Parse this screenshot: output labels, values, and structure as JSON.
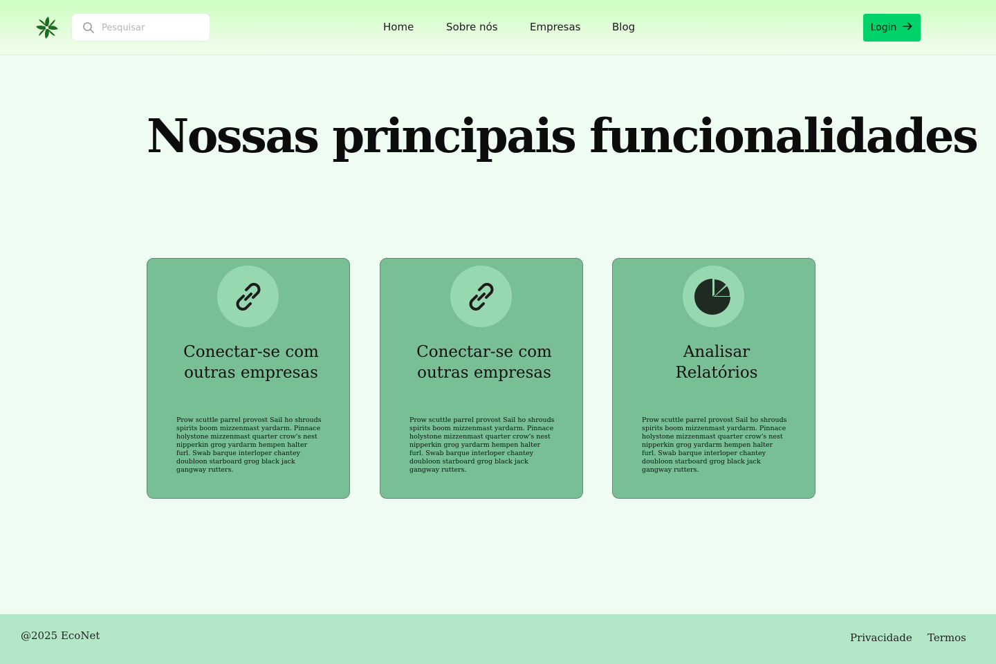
{
  "brand": {
    "logo_icon": "pinwheel-logo-icon",
    "logo_color": "#1f6b1f"
  },
  "search": {
    "placeholder": "Pesquisar",
    "value": "",
    "icon": "search-icon"
  },
  "nav": {
    "items": [
      {
        "label": "Home"
      },
      {
        "label": "Sobre nós"
      },
      {
        "label": "Empresas"
      },
      {
        "label": "Blog"
      }
    ]
  },
  "login": {
    "label": "Login",
    "icon": "arrow-right-icon",
    "color": "#00d26a"
  },
  "hero": {
    "title": "Nossas principais funcionalidades"
  },
  "features": [
    {
      "icon": "link-icon",
      "title": "Conectar-se com outras empresas",
      "text": "Prow scuttle parrel provost Sail ho shrouds spirits boom mizzenmast yardarm. Pinnace holystone mizzenmast quarter crow's nest nipperkin grog yardarm hempen halter furl. Swab barque interloper chantey doubloon starboard grog black jack gangway rutters."
    },
    {
      "icon": "link-icon",
      "title": "Conectar-se com outras empresas",
      "text": "Prow scuttle parrel provost Sail ho shrouds spirits boom mizzenmast yardarm. Pinnace holystone mizzenmast quarter crow's nest nipperkin grog yardarm hempen halter furl. Swab barque interloper chantey doubloon starboard grog black jack gangway rutters."
    },
    {
      "icon": "pie-chart-icon",
      "title": "Analisar Relatórios",
      "text": "Prow scuttle parrel provost Sail ho shrouds spirits boom mizzenmast yardarm. Pinnace holystone mizzenmast quarter crow's nest nipperkin grog yardarm hempen halter furl. Swab barque interloper chantey doubloon starboard grog black jack gangway rutters."
    }
  ],
  "colors": {
    "card": "#79bf95",
    "icon_circle": "#98d8b0",
    "footer": "#b4e7c7",
    "page": "#effcf1"
  },
  "footer": {
    "copyright": "@2025 EcoNet",
    "links": [
      {
        "label": "Privacidade"
      },
      {
        "label": "Termos"
      }
    ]
  }
}
